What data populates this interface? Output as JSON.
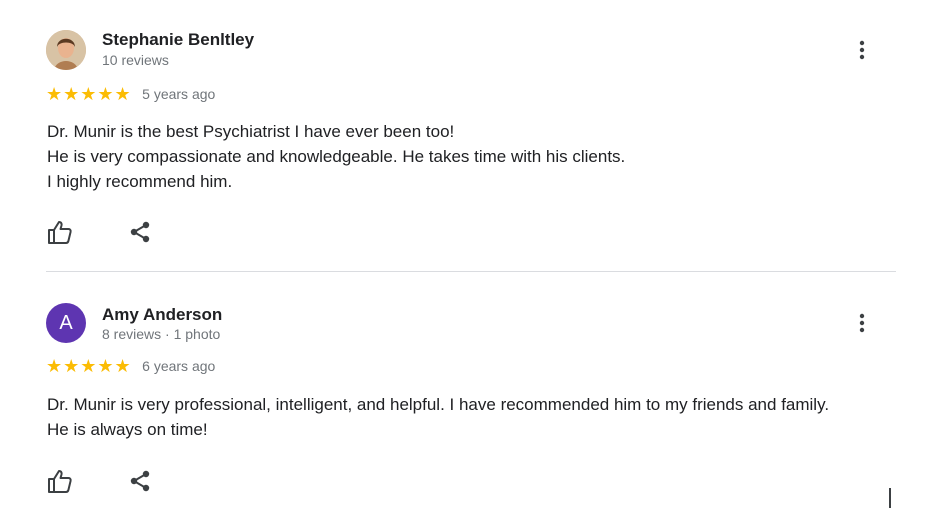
{
  "colors": {
    "star": "#fbbc04",
    "avatar_letter_bg": "#5e35b1",
    "secondary_text": "#70757a",
    "divider": "#dadce0"
  },
  "reviews": [
    {
      "author": "Stephanie Benltley",
      "meta": "10 reviews",
      "avatar": "photo",
      "stars": "★★★★★",
      "rating": 5,
      "time": "5 years ago",
      "lines": [
        "Dr. Munir is the best Psychiatrist I have ever been too!",
        "He is very compassionate and knowledgeable. He takes time with his clients.",
        "I highly recommend him."
      ],
      "icons": {
        "more": "more-vertical-icon",
        "like": "thumbs-up-icon",
        "share": "share-icon"
      }
    },
    {
      "author": "Amy Anderson",
      "meta": "8 reviews · 1 photo",
      "avatar": "A",
      "stars": "★★★★★",
      "rating": 5,
      "time": "6 years ago",
      "lines": [
        "Dr. Munir is very professional, intelligent, and helpful. I have recommended him to my friends and family.",
        "He is always on time!"
      ],
      "icons": {
        "more": "more-vertical-icon",
        "like": "thumbs-up-icon",
        "share": "share-icon"
      }
    }
  ]
}
